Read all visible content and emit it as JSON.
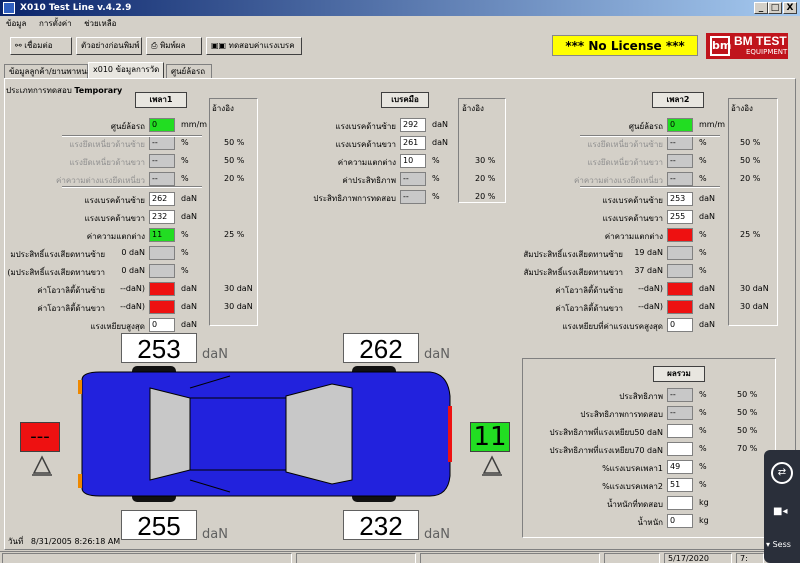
{
  "window": {
    "title": "X010 Test Line v.4.2.9",
    "minimize": "_",
    "restore": "□",
    "close": "X"
  },
  "menu": [
    "ข้อมูล",
    "การตั้งค่า",
    "ช่วยเหลือ"
  ],
  "toolbar": {
    "connect": "เชื่อมต่อ",
    "preview": "ตัวอย่างก่อนพิมพ์",
    "print": "พิมพ์ผล",
    "brake_test": "ทดสอบค่าแรงเบรค"
  },
  "license": "***  No License  ***",
  "logo": {
    "line1": "BM TEST",
    "line2": "EQUIPMENT",
    "mark": "bm"
  },
  "tabs": [
    "ข้อมูลลูกค้า/ยานพาหนะ",
    "x010 ข้อมูลการวัด",
    "ศูนย์ล้อรถ"
  ],
  "test_type": {
    "label": "ประเภทการทดสอบ",
    "value": "Temporary"
  },
  "ref_label": "อ้างอิง",
  "axle1": {
    "title": "เพลา1",
    "rows": [
      {
        "label": "ศูนย์ล้อรถ",
        "value": "0",
        "unit": "mm/m",
        "ref": ""
      },
      {
        "label": "แรงยึดเหนี่ยวด้านซ้าย",
        "value": "--",
        "unit": "%",
        "ref": "50 %"
      },
      {
        "label": "แรงยึดเหนี่ยวด้านขวา",
        "value": "--",
        "unit": "%",
        "ref": "50 %"
      },
      {
        "label": "ค่าความต่างแรงยึดเหนี่ยว",
        "value": "--",
        "unit": "%",
        "ref": "20 %"
      },
      {
        "label": "แรงเบรคด้านซ้าย",
        "value": "262",
        "unit": "daN",
        "ref": ""
      },
      {
        "label": "แรงเบรคด้านขวา",
        "value": "232",
        "unit": "daN",
        "ref": ""
      },
      {
        "label": "ค่าความแตกต่าง",
        "value": "11",
        "unit": "%",
        "ref": "25 %"
      },
      {
        "label": "มประสิทธิ์แรงเสียดทานซ้าย",
        "pre": "0 daN",
        "value": "",
        "unit": "%",
        "ref": ""
      },
      {
        "label": "(มประสิทธิ์แรงเสียดทานขวา",
        "pre": "0 daN",
        "value": "",
        "unit": "%",
        "ref": ""
      },
      {
        "label": "ค่าโอวาลิตี้ด้านซ้าย",
        "pre": "--daN)",
        "value": "",
        "unit": "daN",
        "ref": "30 daN"
      },
      {
        "label": "ค่าโอวาลิตี้ด้านขวา",
        "pre": "--daN)",
        "value": "",
        "unit": "daN",
        "ref": "30 daN"
      },
      {
        "label": "แรงเหยียบสูงสุด",
        "value": "0",
        "unit": "daN",
        "ref": ""
      }
    ]
  },
  "handbrake": {
    "title": "เบรคมือ",
    "rows": [
      {
        "label": "แรงเบรคด้านซ้าย",
        "value": "292",
        "unit": "daN",
        "ref": ""
      },
      {
        "label": "แรงเบรคด้านขวา",
        "value": "261",
        "unit": "daN",
        "ref": ""
      },
      {
        "label": "ค่าความแตกต่าง",
        "value": "10",
        "unit": "%",
        "ref": "30 %"
      },
      {
        "label": "ค่าประสิทธิภาพ",
        "value": "--",
        "unit": "%",
        "ref": "20 %"
      },
      {
        "label": "ประสิทธิภาพการทดสอบ",
        "value": "--",
        "unit": "%",
        "ref": "20 %"
      }
    ]
  },
  "axle2": {
    "title": "เพลา2",
    "rows": [
      {
        "label": "ศูนย์ล้อรถ",
        "value": "0",
        "unit": "mm/m",
        "ref": ""
      },
      {
        "label": "แรงยึดเหนี่ยวด้านซ้าย",
        "value": "--",
        "unit": "%",
        "ref": "50 %"
      },
      {
        "label": "แรงยึดเหนี่ยวด้านขวา",
        "value": "--",
        "unit": "%",
        "ref": "50 %"
      },
      {
        "label": "ค่าความต่างแรงยึดเหนี่ยว",
        "value": "--",
        "unit": "%",
        "ref": "20 %"
      },
      {
        "label": "แรงเบรคด้านซ้าย",
        "value": "253",
        "unit": "daN",
        "ref": ""
      },
      {
        "label": "แรงเบรคด้านขวา",
        "value": "255",
        "unit": "daN",
        "ref": ""
      },
      {
        "label": "ค่าความแตกต่าง",
        "value": "",
        "unit": "%",
        "ref": "25 %"
      },
      {
        "label": "สัมประสิทธิ์แรงเสียดทานซ้าย",
        "pre": "19 daN",
        "value": "",
        "unit": "%",
        "ref": ""
      },
      {
        "label": "สัมประสิทธิ์แรงเสียดทานขวา",
        "pre": "37 daN",
        "value": "",
        "unit": "%",
        "ref": ""
      },
      {
        "label": "ค่าโอวาลิตี้ด้านซ้าย",
        "pre": "--daN)",
        "value": "",
        "unit": "daN",
        "ref": "30 daN"
      },
      {
        "label": "ค่าโอวาลิตี้ด้านขวา",
        "pre": "--daN)",
        "value": "",
        "unit": "daN",
        "ref": "30 daN"
      },
      {
        "label": "แรงเหยียบที่ค่าแรงเบรคสูงสุด",
        "value": "0",
        "unit": "daN",
        "ref": ""
      }
    ]
  },
  "summary": {
    "title": "ผลรวม",
    "rows": [
      {
        "label": "ประสิทธิภาพ",
        "value": "--",
        "unit": "%",
        "ref": "50 %"
      },
      {
        "label": "ประสิทธิภาพการทดสอบ",
        "value": "--",
        "unit": "%",
        "ref": "50 %"
      },
      {
        "label": "ประสิทธิภาพที่แรงเหยียบ50 daN",
        "value": "",
        "unit": "%",
        "ref": "50 %"
      },
      {
        "label": "ประสิทธิภาพที่แรงเหยียบ70 daN",
        "value": "",
        "unit": "%",
        "ref": "70 %"
      },
      {
        "label": "%แรงเบรคเพลา1",
        "value": "49",
        "unit": "%",
        "ref": ""
      },
      {
        "label": "%แรงเบรคเพลา2",
        "value": "51",
        "unit": "%",
        "ref": ""
      },
      {
        "label": "น้ำหนักที่ทดสอบ",
        "value": "",
        "unit": "kg",
        "ref": ""
      },
      {
        "label": "น้ำหนัก",
        "value": "0",
        "unit": "kg",
        "ref": ""
      }
    ]
  },
  "car": {
    "front_left": "253",
    "front_right": "262",
    "rear_left": "255",
    "rear_right": "232",
    "unit": "daN",
    "left_indicator": "---",
    "right_indicator": "11",
    "colors": {
      "body": "#2222dd",
      "glass": "#c8c8c8",
      "ok": "#22dd22",
      "alert": "#ee1111"
    }
  },
  "date_label": "วันที่",
  "date_value": "8/31/2005 8:26:18 AM",
  "status": {
    "date": "5/17/2020",
    "time": "7:"
  },
  "teamviewer": {
    "label": "Sess"
  }
}
